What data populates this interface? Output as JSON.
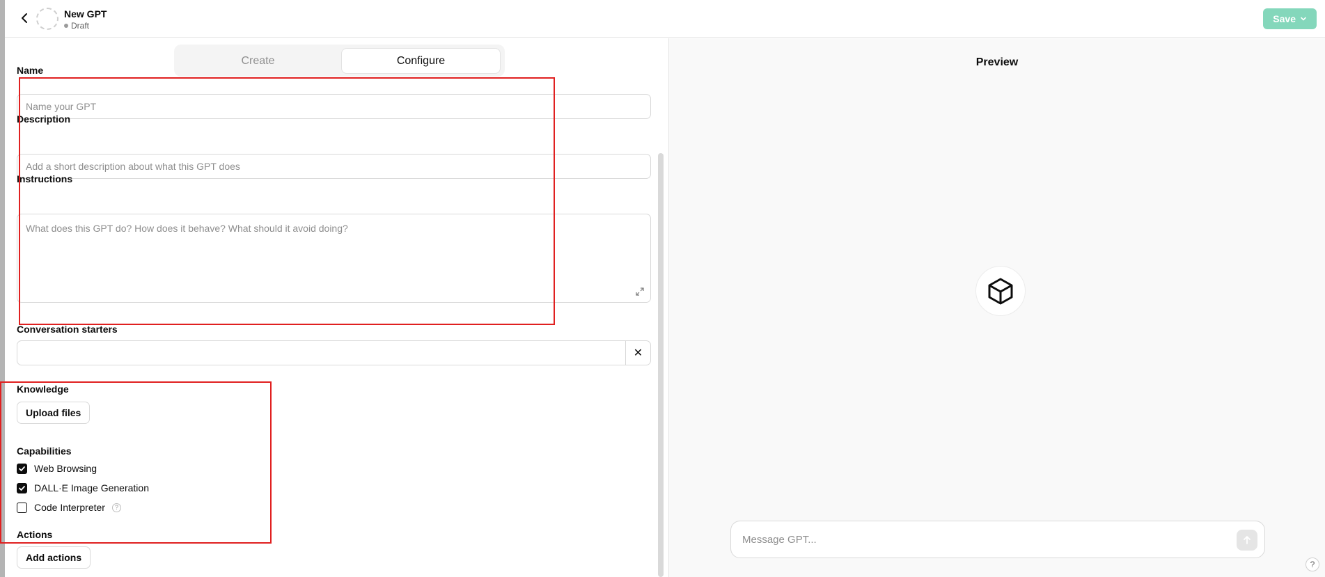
{
  "header": {
    "title": "New GPT",
    "status": "Draft",
    "save_label": "Save"
  },
  "tabs": [
    {
      "label": "Create",
      "active": false
    },
    {
      "label": "Configure",
      "active": true
    }
  ],
  "form": {
    "name": {
      "label": "Name",
      "placeholder": "Name your GPT"
    },
    "description": {
      "label": "Description",
      "placeholder": "Add a short description about what this GPT does"
    },
    "instructions": {
      "label": "Instructions",
      "placeholder": "What does this GPT do? How does it behave? What should it avoid doing?"
    },
    "conversation_starters": {
      "label": "Conversation starters",
      "clear_symbol": "✕"
    },
    "knowledge": {
      "label": "Knowledge",
      "upload_label": "Upload files"
    },
    "capabilities": {
      "label": "Capabilities",
      "items": [
        {
          "label": "Web Browsing",
          "checked": true
        },
        {
          "label": "DALL·E Image Generation",
          "checked": true
        },
        {
          "label": "Code Interpreter",
          "checked": false,
          "help": "?"
        }
      ]
    },
    "actions": {
      "label": "Actions",
      "add_label": "Add actions"
    }
  },
  "preview": {
    "title": "Preview",
    "message_placeholder": "Message GPT...",
    "help": "?"
  },
  "colors": {
    "save_button": "#84d7bb",
    "annotation_box": "#e02020"
  }
}
